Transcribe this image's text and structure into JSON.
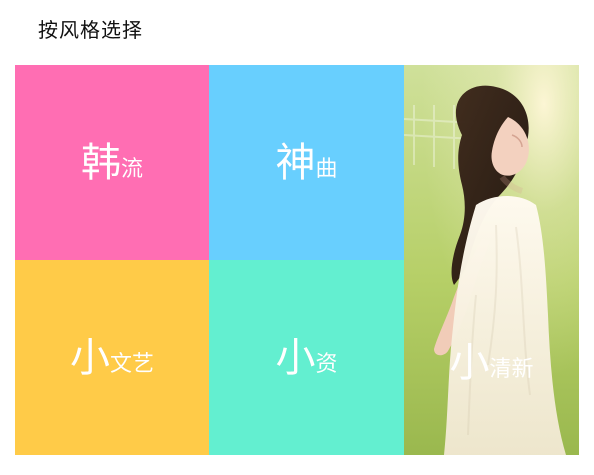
{
  "header": {
    "title": "按风格选择"
  },
  "tiles": [
    {
      "big": "韩",
      "small": "流",
      "color": "#ff6eb3"
    },
    {
      "big": "神",
      "small": "曲",
      "color": "#68cffe"
    },
    {
      "big": "小",
      "small": "文艺",
      "color": "#ffcb48"
    },
    {
      "big": "小",
      "small": "资",
      "color": "#63efd0"
    },
    {
      "big": "小",
      "small": "清新",
      "color": "#b7d46a"
    }
  ]
}
